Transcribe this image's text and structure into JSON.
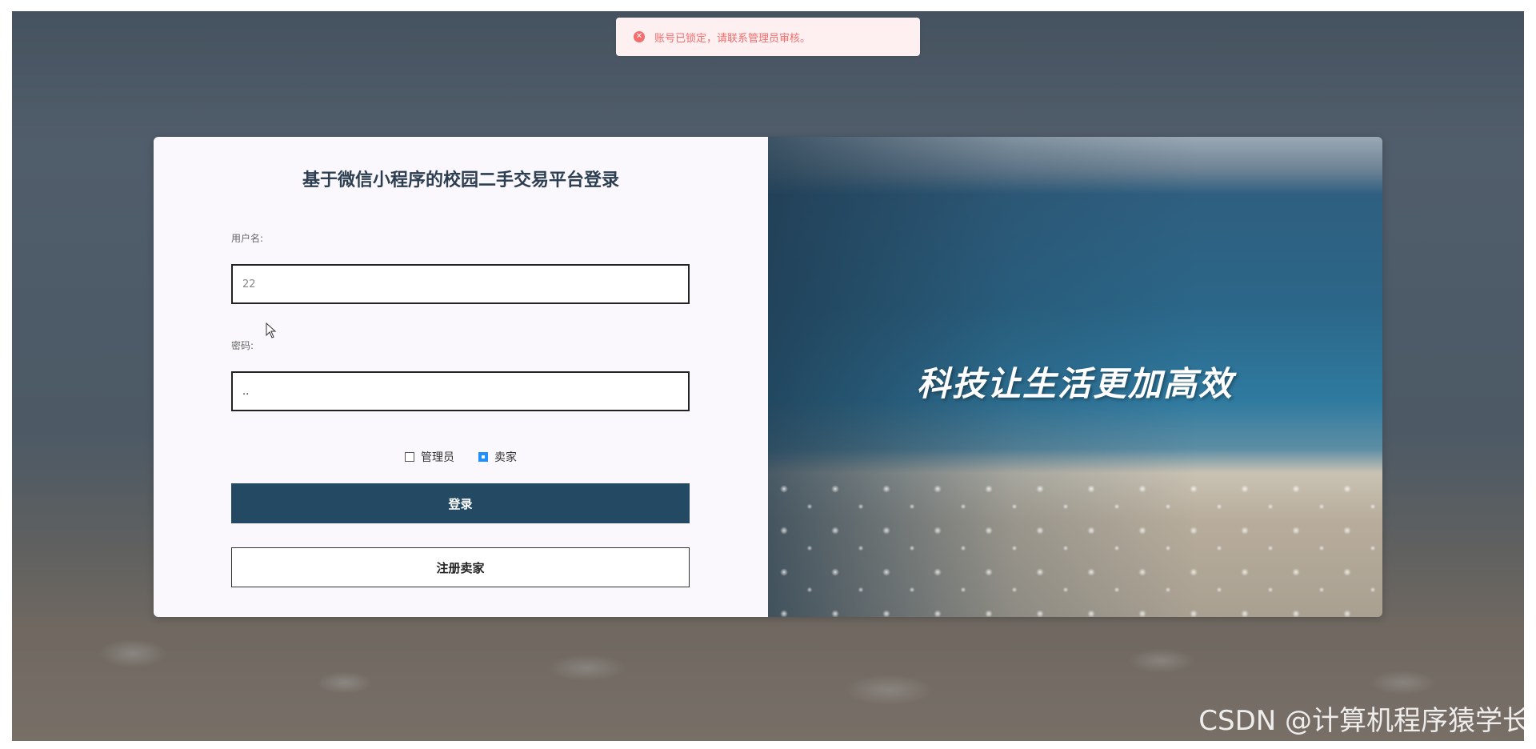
{
  "toast": {
    "icon": "error-icon",
    "message": "账号已锁定，请联系管理员审核。",
    "color": "#f56c6c"
  },
  "login": {
    "title": "基于微信小程序的校园二手交易平台登录",
    "username_label": "用户名:",
    "username_value": "22",
    "password_label": "密码:",
    "password_value": "..",
    "roles": [
      {
        "label": "管理员",
        "checked": false
      },
      {
        "label": "卖家",
        "checked": true
      }
    ],
    "login_button": "登录",
    "register_button": "注册卖家"
  },
  "banner": {
    "slogan": "科技让生活更加高效"
  },
  "watermark": "CSDN @计算机程序猿学长",
  "colors": {
    "primary_button": "#244a63",
    "checkbox_checked": "#1e90ff"
  }
}
